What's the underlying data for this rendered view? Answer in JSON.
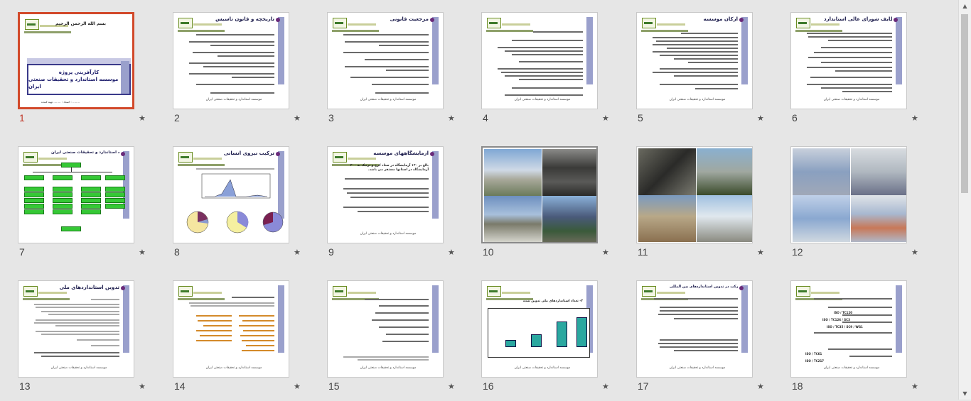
{
  "slides": [
    {
      "number": "1",
      "title": "بسم الله الرحمن الرحيم",
      "heading": "کارآفرینی پروژه",
      "subheading": "موسسه استاندارد و تحقیقات صنعتی ایران",
      "footer": "استاد : ........  تهیه کننده : ........"
    },
    {
      "number": "2",
      "title": "تاریخچه و قانون تاسیس",
      "footer": "موسسه استاندارد و تحقیقات صنعتی ایران"
    },
    {
      "number": "3",
      "title": "مرجعیت قانونی",
      "footer": "موسسه استاندارد و تحقیقات صنعتی ایران"
    },
    {
      "number": "4",
      "title": "",
      "footer": "موسسه استاندارد و تحقیقات صنعتی ایران"
    },
    {
      "number": "5",
      "title": "ارکان موسسه",
      "footer": "موسسه استاندارد و تحقیقات صنعتی ایران"
    },
    {
      "number": "6",
      "title": "امور وظایف شورای عالی استاندارد",
      "footer": "موسسه استاندارد و تحقیقات صنعتی ایران"
    },
    {
      "number": "7",
      "title": "نمودار سازمانی موسسه استاندارد و تحقیقات صنعتی ایران",
      "footer": ""
    },
    {
      "number": "8",
      "title": "ترکیب نیروی انسانی",
      "footer": ""
    },
    {
      "number": "9",
      "title": "آزمایشگاههای موسسه",
      "footer": "موسسه استاندارد و تحقیقات صنعتی ایران"
    },
    {
      "number": "10",
      "title": "",
      "footer": ""
    },
    {
      "number": "11",
      "title": "",
      "footer": ""
    },
    {
      "number": "12",
      "title": "",
      "footer": ""
    },
    {
      "number": "13",
      "title": "تدوین استانداردهای ملی",
      "footer": "موسسه استاندارد و تحقیقات صنعتی ایران"
    },
    {
      "number": "14",
      "title": "",
      "footer": "موسسه استاندارد و تحقیقات صنعتی ایران"
    },
    {
      "number": "15",
      "title": "",
      "footer": "موسسه استاندارد و تحقیقات صنعتی ایران"
    },
    {
      "number": "16",
      "title": "",
      "footer": "موسسه استاندارد و تحقیقات صنعتی ایران"
    },
    {
      "number": "17",
      "title": "مشارکت در تدوین استانداردهای بین المللی",
      "footer": "موسسه استاندارد و تحقیقات صنعتی ایران"
    },
    {
      "number": "18",
      "title": "",
      "footer": "موسسه استاندارد و تحقیقات صنعتی ایران"
    }
  ],
  "slide9_text": {
    "line1": "بالغ بر ۱۲۰ آزمایشگاه در ستاد کرج و ترتیک به ۲۰۰ آزمایشگاه در استانها مستقر می باشد."
  },
  "slide16_chart_title": "۳- تعداد استانداردهای ملی تدوین شده",
  "slide18_lines": [
    "ISO / TC120",
    "ISO / TC126 / SC3",
    "ISO / TC35 / SC9 / WG1",
    "ISO / TC61",
    "ISO / TC217"
  ],
  "star_glyph": "★",
  "colors": {
    "selection_border": "#d2492a",
    "accent_sidebar": "#9aa0cc"
  }
}
